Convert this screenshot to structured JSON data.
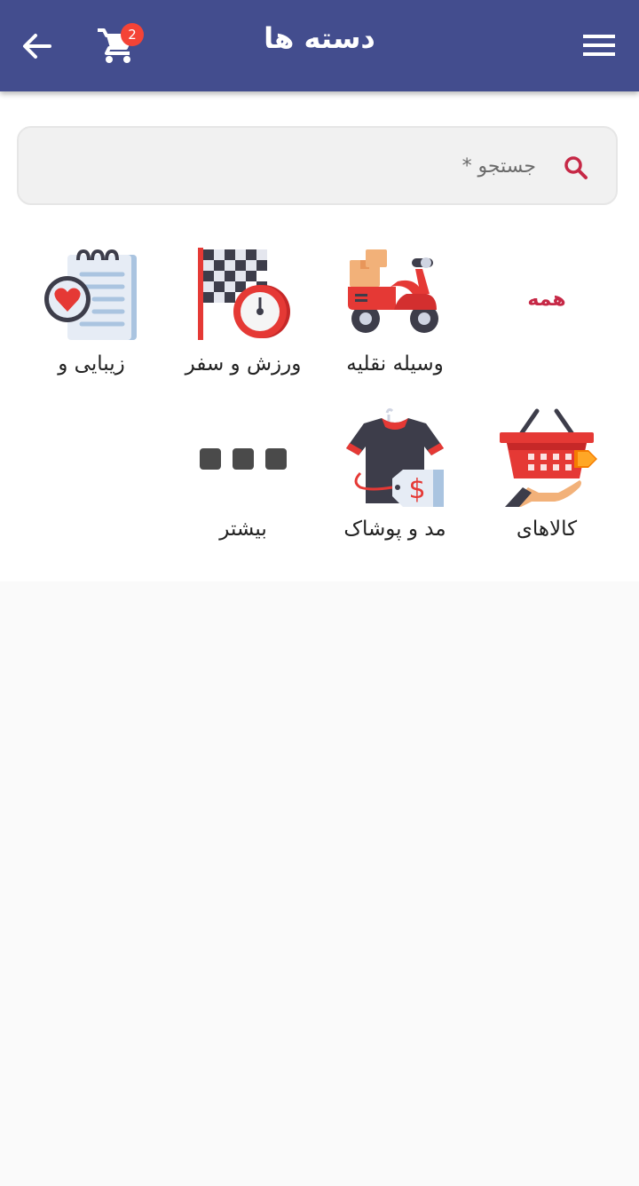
{
  "app_bar": {
    "title": "دسته ها",
    "cart_count": "2",
    "back_icon": "arrow-left-icon",
    "cart_icon": "shopping-cart-icon",
    "menu_icon": "hamburger-menu-icon",
    "color": "#434d8e"
  },
  "search": {
    "placeholder": "جستجو *",
    "icon": "search-icon",
    "icon_color": "#c62846"
  },
  "categories": [
    {
      "label": "همه",
      "icon": "none"
    },
    {
      "label": "وسیله نقلیه",
      "icon": "scooter-icon"
    },
    {
      "label": "ورزش و سفر",
      "icon": "checkered-flag-icon"
    },
    {
      "label": "زیبایی و",
      "icon": "notebook-heart-icon"
    },
    {
      "label": "کالاهای",
      "icon": "shopping-basket-icon"
    },
    {
      "label": "مد و پوشاک",
      "icon": "shirt-price-tag-icon"
    },
    {
      "label": "بیشتر",
      "icon": "more-dots-icon"
    }
  ]
}
